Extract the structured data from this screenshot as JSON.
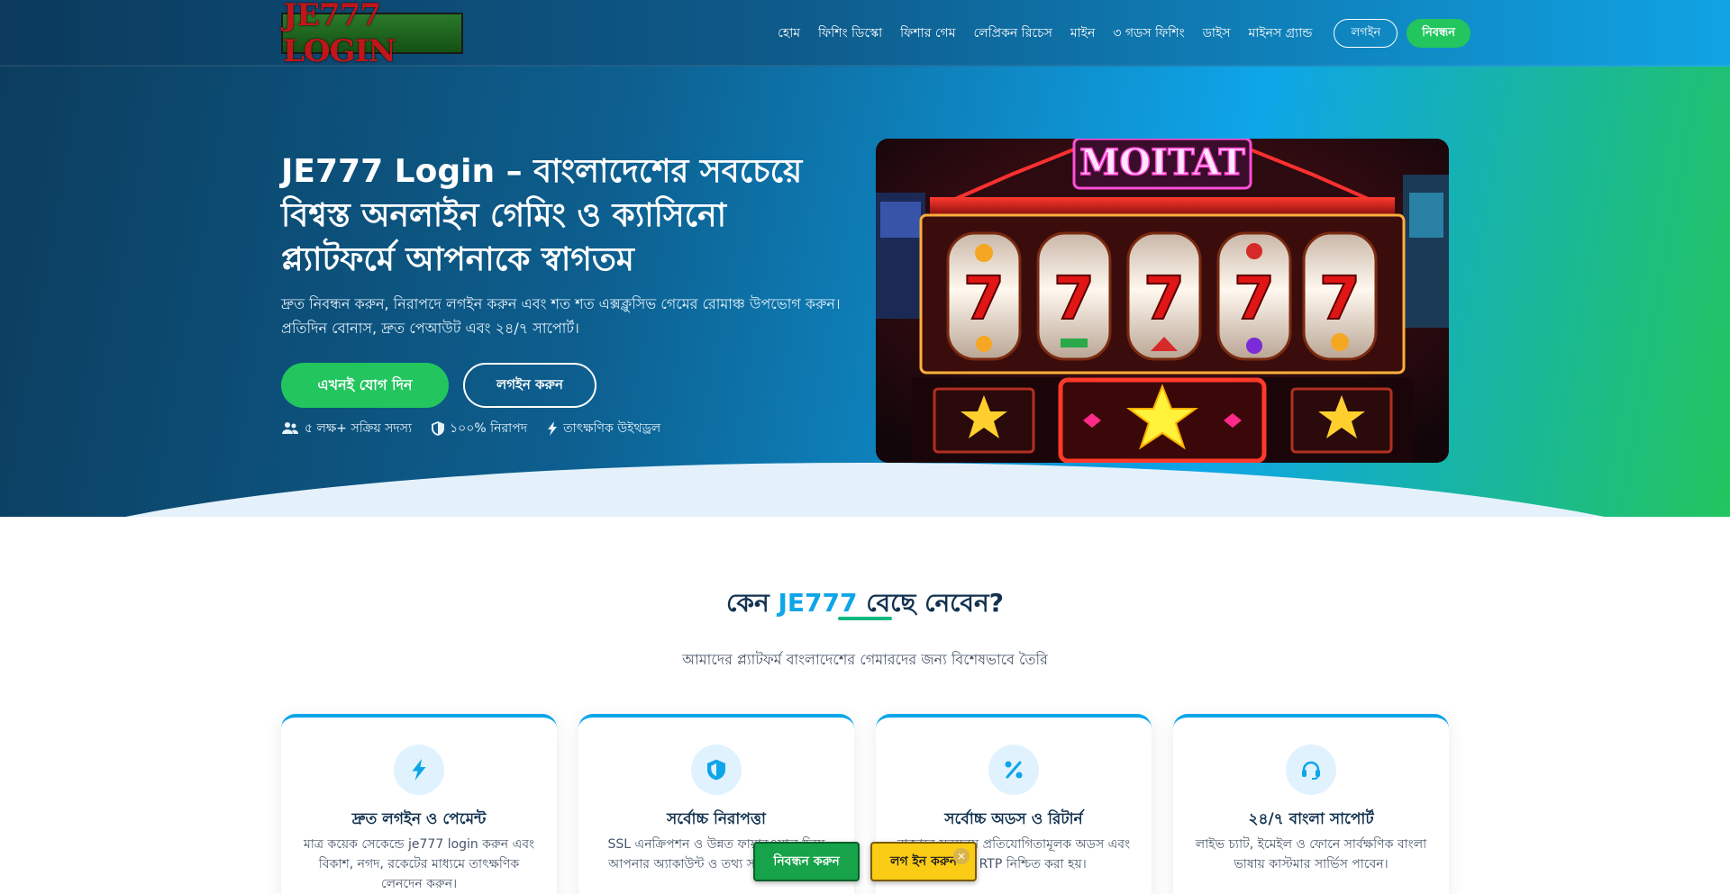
{
  "header": {
    "logo_text": "JE777 LOGIN",
    "nav": [
      "হোম",
      "ফিশিং ডিস্কো",
      "ফিশার গেম",
      "লেপ্রিকন রিচেস",
      "মাইন",
      "৩ গডস ফিশিং",
      "ডাইস",
      "মাইনস গ্র্যান্ড"
    ],
    "login_label": "লগইন",
    "register_label": "নিবন্ধন"
  },
  "hero": {
    "title": "JE777 Login – বাংলাদেশের সবচেয়ে বিশ্বস্ত অনলাইন গেমিং ও ক্যাসিনো প্ল্যাটফর্মে আপনাকে স্বাগতম",
    "subtitle": "দ্রুত নিবন্ধন করুন, নিরাপদে লগইন করুন এবং শত শত এক্সক্লুসিভ গেমের রোমাঞ্চ উপভোগ করুন। প্রতিদিন বোনাস, দ্রুত পেআউট এবং ২৪/৭ সাপোর্ট।",
    "join_button": "এখনই যোগ দিন",
    "login_button": "লগইন করুন",
    "stats": [
      {
        "icon": "users-icon",
        "text": "৫ লক্ষ+ সক্রিয় সদস্য"
      },
      {
        "icon": "shield-icon",
        "text": "১০০% নিরাপদ"
      },
      {
        "icon": "bolt-icon",
        "text": "তাৎক্ষণিক উইথড্রল"
      }
    ],
    "image_sign": "MOITAT"
  },
  "features": {
    "title_prefix": "কেন",
    "title_accent": "JE777",
    "title_suffix": "বেছে নেবেন?",
    "subtitle": "আমাদের প্ল্যাটফর্ম বাংলাদেশের গেমারদের জন্য বিশেষভাবে তৈরি",
    "cards": [
      {
        "icon": "bolt-icon",
        "title": "দ্রুত লগইন ও পেমেন্ট",
        "desc": "মাত্র কয়েক সেকেন্ডে je777 login করুন এবং বিকাশ, নগদ, রকেটের মাধ্যমে তাৎক্ষণিক লেনদেন করুন।"
      },
      {
        "icon": "shield-icon",
        "title": "সর্বোচ্চ নিরাপত্তা",
        "desc": "SSL এনক্রিপশন ও উন্নত ফায়ারওয়াল দিয়ে আপনার অ্যাকাউন্ট ও তথ্য সম্পূর্ণ সুরক্ষিত।"
      },
      {
        "icon": "percent-icon",
        "title": "সর্বোচ্চ অডস ও রিটার্ন",
        "desc": "বাজারে সবচেয়ে প্রতিযোগিতামূলক অডস এবং সর্বোচ্চ RTP নিশ্চিত করা হয়।"
      },
      {
        "icon": "headset-icon",
        "title": "২৪/৭ বাংলা সাপোর্ট",
        "desc": "লাইভ চ্যাট, ইমেইল ও ফোনে সার্বক্ষণিক বাংলা ভাষায় কাস্টমার সার্ভিস পাবেন।"
      }
    ]
  },
  "floating": {
    "register": "নিবন্ধন করুন",
    "login": "লগ ইন করুন",
    "close": "✕"
  },
  "colors": {
    "accent_blue": "#0ea5e9",
    "accent_green": "#22c55e",
    "dark_navy": "#12324f",
    "yellow": "#facc15"
  }
}
